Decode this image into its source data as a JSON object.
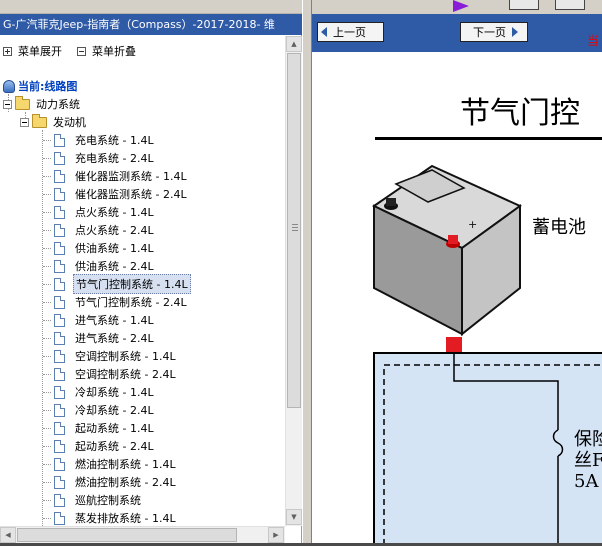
{
  "left_pane": {
    "title": "G-广汽菲克Jeep-指南者（Compass）-2017-2018- 维",
    "menu_expand": "菜单展开",
    "menu_collapse": "菜单折叠",
    "current_label": "当前:线路图",
    "tree": {
      "level1": "动力系统",
      "level2": "发动机",
      "items": [
        "充电系统 - 1.4L",
        "充电系统 - 2.4L",
        "催化器监测系统 - 1.4L",
        "催化器监测系统 - 2.4L",
        "点火系统 - 1.4L",
        "点火系统 - 2.4L",
        "供油系统 - 1.4L",
        "供油系统 - 2.4L",
        "节气门控制系统 - 1.4L",
        "节气门控制系统 - 2.4L",
        "进气系统 - 1.4L",
        "进气系统 - 2.4L",
        "空调控制系统 - 1.4L",
        "空调控制系统 - 2.4L",
        "冷却系统 - 1.4L",
        "冷却系统 - 2.4L",
        "起动系统 - 1.4L",
        "起动系统 - 2.4L",
        "燃油控制系统 - 1.4L",
        "燃油控制系统 - 2.4L",
        "巡航控制系统",
        "蒸发排放系统 - 1.4L"
      ],
      "selected_index": 8
    }
  },
  "right_pane": {
    "prev_page": "上一页",
    "next_page": "下一页",
    "current_indicator": "当",
    "diagram": {
      "title": "节气门控",
      "battery_label": "蓄电池",
      "fuse_label_line1": "保险",
      "fuse_label_line2": "丝F",
      "fuse_label_line3": "5A"
    }
  },
  "colors": {
    "title_bar": "#2f5aa6",
    "selected_row": "#d6e0f0",
    "fuse_box_fill": "#d4e4f5",
    "connector_red": "#e31b23"
  }
}
